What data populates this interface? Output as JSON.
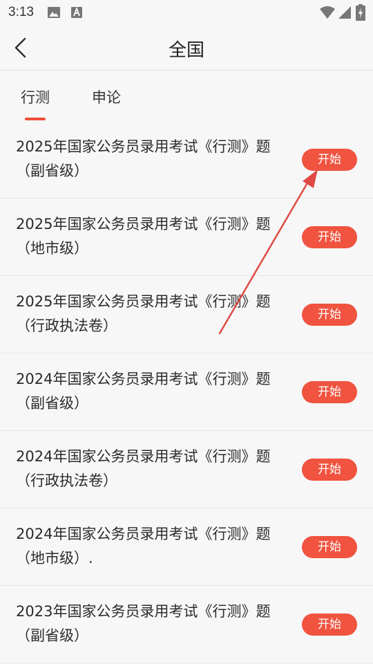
{
  "status_bar": {
    "time": "3:13"
  },
  "header": {
    "title": "全国"
  },
  "tabs": [
    {
      "label": "行测",
      "active": true
    },
    {
      "label": "申论",
      "active": false
    }
  ],
  "papers": [
    {
      "title": "2025年国家公务员录用考试《行测》题（副省级）",
      "action": "开始"
    },
    {
      "title": "2025年国家公务员录用考试《行测》题（地市级）",
      "action": "开始"
    },
    {
      "title": "2025年国家公务员录用考试《行测》题（行政执法卷）",
      "action": "开始"
    },
    {
      "title": "2024年国家公务员录用考试《行测》题（副省级）",
      "action": "开始"
    },
    {
      "title": "2024年国家公务员录用考试《行测》题（行政执法卷）",
      "action": "开始"
    },
    {
      "title": "2024年国家公务员录用考试《行测》题（地市级）.",
      "action": "开始"
    },
    {
      "title": "2023年国家公务员录用考试《行测》题（副省级）",
      "action": "开始"
    }
  ],
  "colors": {
    "accent": "#f0533f",
    "annotation": "#e04a44"
  }
}
